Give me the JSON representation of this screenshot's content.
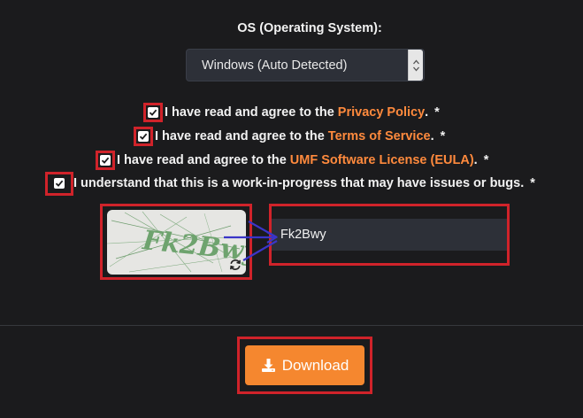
{
  "os": {
    "label": "OS (Operating System):",
    "selected": "Windows (Auto Detected)",
    "arrow_icon": "select-arrows-icon"
  },
  "agreements": [
    {
      "prefix": "I have read and agree to the",
      "link": "Privacy Policy",
      "suffix": ".",
      "required": "*",
      "checked": true
    },
    {
      "prefix": "I have read and agree to the",
      "link": "Terms of Service",
      "suffix": ".",
      "required": "*",
      "checked": true
    },
    {
      "prefix": "I have read and agree to the",
      "link": "UMF Software License (EULA)",
      "suffix": ".",
      "required": "*",
      "checked": true
    },
    {
      "prefix": "I understand that this is a work-in-progress that may have issues or bugs.",
      "required": "*",
      "checked": true
    }
  ],
  "captcha": {
    "image_text": "Fk2Bwy",
    "refresh_icon": "refresh-icon",
    "input_value": "Fk2Bwy"
  },
  "download": {
    "label": "Download",
    "icon": "download-icon"
  },
  "colors": {
    "background": "#1b1b1d",
    "accent_orange": "#f5872f",
    "link_orange": "#ff8a3d",
    "annotation_red": "#d0232a",
    "annotation_arrow": "#3a35c8",
    "input_bg": "#2d3038"
  }
}
